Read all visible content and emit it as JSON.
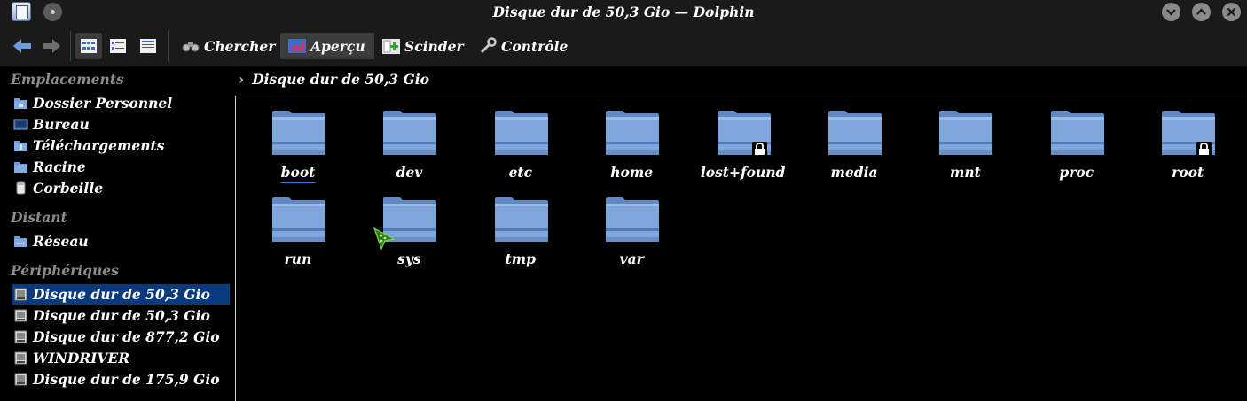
{
  "window": {
    "title": "Disque dur de 50,3 Gio — Dolphin"
  },
  "toolbar": {
    "search_label": "Chercher",
    "preview_label": "Aperçu",
    "split_label": "Scinder",
    "control_label": "Contrôle"
  },
  "sidebar": {
    "sections": {
      "places": "Emplacements",
      "remote": "Distant",
      "devices": "Périphériques"
    },
    "places": [
      {
        "label": "Dossier Personnel",
        "icon": "home-folder-icon"
      },
      {
        "label": "Bureau",
        "icon": "desktop-icon"
      },
      {
        "label": "Téléchargements",
        "icon": "downloads-folder-icon"
      },
      {
        "label": "Racine",
        "icon": "root-folder-icon"
      },
      {
        "label": "Corbeille",
        "icon": "trash-icon"
      }
    ],
    "remote": [
      {
        "label": "Réseau",
        "icon": "network-folder-icon"
      }
    ],
    "devices": [
      {
        "label": "Disque dur de 50,3 Gio",
        "icon": "hard-drive-icon",
        "selected": true
      },
      {
        "label": "Disque dur de 50,3 Gio",
        "icon": "hard-drive-icon"
      },
      {
        "label": "Disque dur de 877,2 Gio",
        "icon": "hard-drive-icon"
      },
      {
        "label": "WINDRIVER",
        "icon": "hard-drive-icon"
      },
      {
        "label": "Disque dur de 175,9 Gio",
        "icon": "hard-drive-icon"
      }
    ]
  },
  "breadcrumb": {
    "current": "Disque dur de 50,3 Gio"
  },
  "files": [
    {
      "name": "boot",
      "locked": false
    },
    {
      "name": "dev",
      "locked": false
    },
    {
      "name": "etc",
      "locked": false
    },
    {
      "name": "home",
      "locked": false
    },
    {
      "name": "lost+found",
      "locked": true
    },
    {
      "name": "media",
      "locked": false
    },
    {
      "name": "mnt",
      "locked": false
    },
    {
      "name": "proc",
      "locked": false
    },
    {
      "name": "root",
      "locked": true
    },
    {
      "name": "run",
      "locked": false
    },
    {
      "name": "sys",
      "locked": false
    },
    {
      "name": "tmp",
      "locked": false
    },
    {
      "name": "var",
      "locked": false
    }
  ],
  "colors": {
    "accent": "#0a3a7e",
    "folder": "#7fa6dc",
    "background": "#000000",
    "chrome": "#1a1a1a"
  }
}
